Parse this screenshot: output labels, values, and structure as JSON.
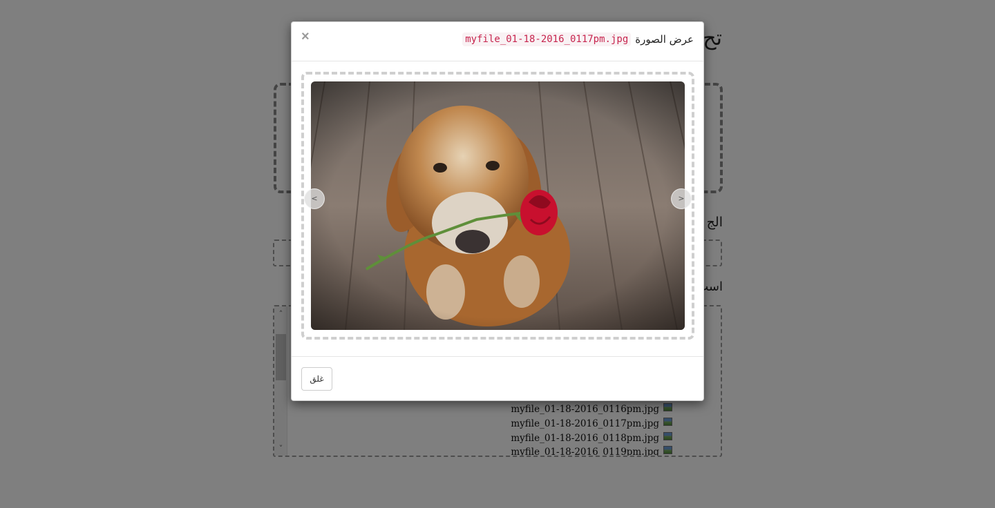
{
  "background": {
    "page_title": "تح",
    "group_label": "الج",
    "files_label": "است",
    "file_list": [
      "myfile_01-18-2016_0116pm.jpg",
      "myfile_01-18-2016_0117pm.jpg",
      "myfile_01-18-2016_0118pm.jpg",
      "myfile_01-18-2016_0119pm.jpg"
    ],
    "scroll_up": "˄",
    "scroll_down": "˅"
  },
  "modal": {
    "title": "عرض الصورة",
    "filename": "myfile_01-18-2016_0117pm.jpg",
    "close_symbol": "×",
    "prev_symbol": "<",
    "next_symbol": ">",
    "footer_button": "غلق",
    "image_subject": "dog holding a red rose on a wooden deck"
  },
  "colors": {
    "overlay": "rgba(0,0,0,0.5)",
    "code_text": "#c7254e",
    "code_bg": "#f9f2f4"
  }
}
